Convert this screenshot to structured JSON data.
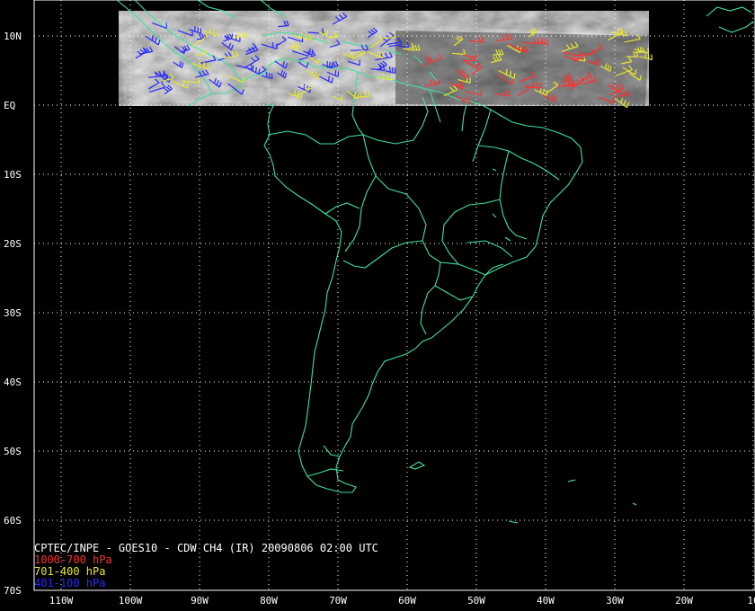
{
  "title": "CPTEC/INPE - GOES10 - CDW CH4 (IR) 20090806 02:00 UTC",
  "legend": [
    {
      "label": "1000-700 hPa",
      "color": "#ff3030"
    },
    {
      "label": "701-400 hPa",
      "color": "#e8e830"
    },
    {
      "label": "401-100 hPa",
      "color": "#2828ff"
    }
  ],
  "colors": {
    "background": "#000000",
    "coastline": "#40e0a0",
    "grid": "#ffffff",
    "text": "#ffffff"
  },
  "lat_labels": [
    "10N",
    "EQ",
    "10S",
    "20S",
    "30S",
    "40S",
    "50S",
    "60S",
    "70S"
  ],
  "lon_labels": [
    "110W",
    "100W",
    "90W",
    "80W",
    "70W",
    "60W",
    "50W",
    "40W",
    "30W",
    "20W",
    "10"
  ],
  "satellite_strip": {
    "lon_min": -101,
    "lon_max": -26,
    "lat_min": 0,
    "lat_max": 10
  }
}
